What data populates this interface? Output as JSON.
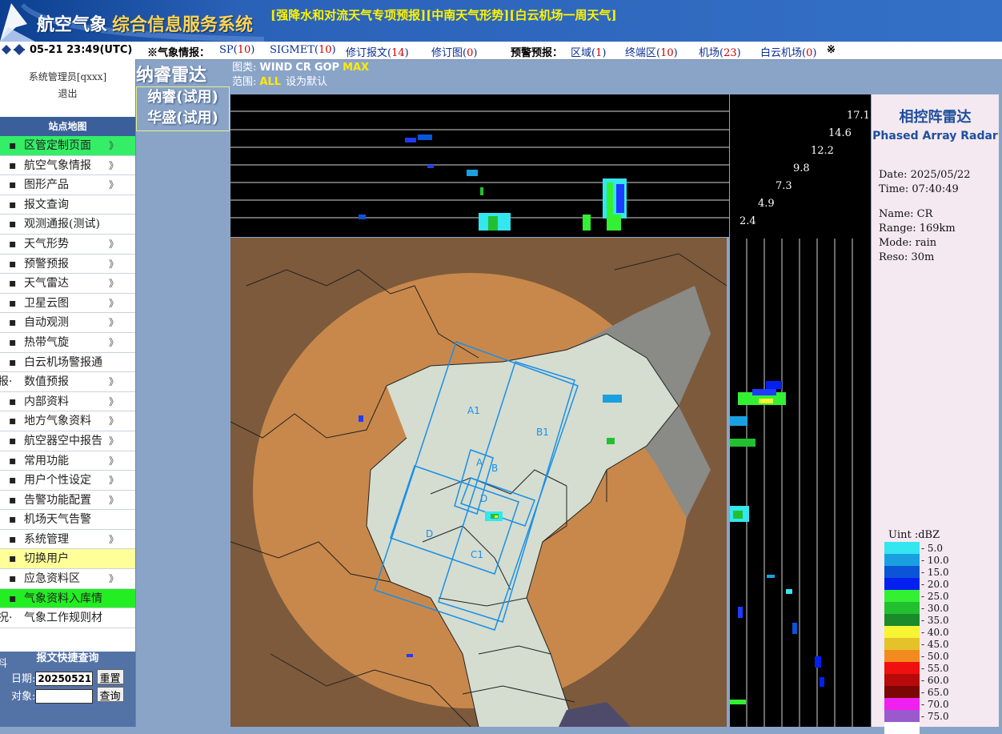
{
  "header": {
    "title_part1": "航空气象",
    "title_part2": "综合信息服务系统",
    "links": [
      "[强降水和对流天气专项预报]",
      "[中南天气形势]",
      "[白云机场一周天气]"
    ]
  },
  "infobar": {
    "clock": "05-21 23:49(UTC)",
    "weather_label": "※气象情报：",
    "items": [
      {
        "label": "SP",
        "count": "10"
      },
      {
        "label": "SIGMET",
        "count": "10"
      },
      {
        "label": "修订报文",
        "count": "14"
      },
      {
        "label": "修订图",
        "count": "0"
      }
    ],
    "warn_label": "预警预报：",
    "warn_items": [
      {
        "label": "区域",
        "count": "1"
      },
      {
        "label": "终端区",
        "count": "10"
      },
      {
        "label": "机场",
        "count": "23"
      },
      {
        "label": "白云机场",
        "count": "0"
      }
    ],
    "end_mark": "※"
  },
  "sidebar": {
    "user": "系统管理员[qxxx]",
    "logout": "退出",
    "nav_title": "站点地图",
    "items": [
      {
        "label": "区管定制页面",
        "chevron": true,
        "style": "green"
      },
      {
        "label": "航空气象情报",
        "chevron": true
      },
      {
        "label": "图形产品",
        "chevron": true
      },
      {
        "label": "报文查询",
        "chevron": false
      },
      {
        "label": "观测通报(测试)",
        "chevron": false
      },
      {
        "label": "天气形势",
        "chevron": true
      },
      {
        "label": "预警预报",
        "chevron": true
      },
      {
        "label": "天气雷达",
        "chevron": true
      },
      {
        "label": "卫星云图",
        "chevron": true
      },
      {
        "label": "自动观测",
        "chevron": true
      },
      {
        "label": "热带气旋",
        "chevron": true
      },
      {
        "label": "白云机场警报通",
        "chevron": false
      },
      {
        "label": "数值预报",
        "chevron": true,
        "prefix": "报·"
      },
      {
        "label": "内部资料",
        "chevron": true
      },
      {
        "label": "地方气象资料",
        "chevron": true
      },
      {
        "label": "航空器空中报告",
        "chevron": true
      },
      {
        "label": "常用功能",
        "chevron": true
      },
      {
        "label": "用户个性设定",
        "chevron": true
      },
      {
        "label": "告警功能配置",
        "chevron": true
      },
      {
        "label": "机场天气告警",
        "chevron": false
      },
      {
        "label": "系统管理",
        "chevron": true
      },
      {
        "label": "切换用户",
        "chevron": false,
        "style": "yellow"
      },
      {
        "label": "应急资料区",
        "chevron": true
      },
      {
        "label": "气象资料入库情",
        "chevron": false,
        "style": "lime"
      },
      {
        "label": "气象工作规则材",
        "chevron": false,
        "prefix": "况·"
      }
    ],
    "quick_title": "报文快捷查询",
    "date_label": "日期:",
    "date_value": "20250521",
    "reset_label": "重置",
    "object_label": "对象:",
    "query_label": "查询",
    "left_cut": "料"
  },
  "radar": {
    "title": "纳睿雷达",
    "list": [
      "纳睿(试用)",
      "华盛(试用)"
    ]
  },
  "controls": {
    "type_label": "图类:",
    "type_options": [
      "WIND",
      "CR",
      "GOP"
    ],
    "type_selected": "MAX",
    "range_label": "范围:",
    "range_selected": "ALL",
    "range_default": "设为默认"
  },
  "heights": [
    "17.1",
    "14.6",
    "12.2",
    "9.8",
    "7.3",
    "4.9",
    "2.4"
  ],
  "map_labels": [
    "A1",
    "B1",
    "A",
    "B",
    "D",
    "D",
    "C1"
  ],
  "info": {
    "title_cn": "相控阵雷达",
    "title_en": "Phased Array Radar",
    "date": "Date: 2025/05/22",
    "time": "Time: 07:40:49",
    "name": "Name: CR",
    "range": "Range: 169km",
    "mode": "Mode: rain",
    "reso": "Reso: 30m"
  },
  "legend": {
    "unit": "Uint :dBZ",
    "items": [
      {
        "label": "- 5.0",
        "color": "#33e6f0"
      },
      {
        "label": "- 10.0",
        "color": "#1aa0e0"
      },
      {
        "label": "- 15.0",
        "color": "#0b54d8"
      },
      {
        "label": "- 20.0",
        "color": "#0320f0"
      },
      {
        "label": "- 25.0",
        "color": "#33f033"
      },
      {
        "label": "- 30.0",
        "color": "#22c030"
      },
      {
        "label": "- 35.0",
        "color": "#1a8a2a"
      },
      {
        "label": "- 40.0",
        "color": "#f6f433"
      },
      {
        "label": "- 45.0",
        "color": "#e6c22a"
      },
      {
        "label": "- 50.0",
        "color": "#f38a1e"
      },
      {
        "label": "- 55.0",
        "color": "#f01010"
      },
      {
        "label": "- 60.0",
        "color": "#b80a0a"
      },
      {
        "label": "- 65.0",
        "color": "#7a0606"
      },
      {
        "label": "- 70.0",
        "color": "#f020f0"
      },
      {
        "label": "- 75.0",
        "color": "#9a5acd"
      },
      {
        "label": "",
        "color": "#ffffff"
      }
    ]
  }
}
